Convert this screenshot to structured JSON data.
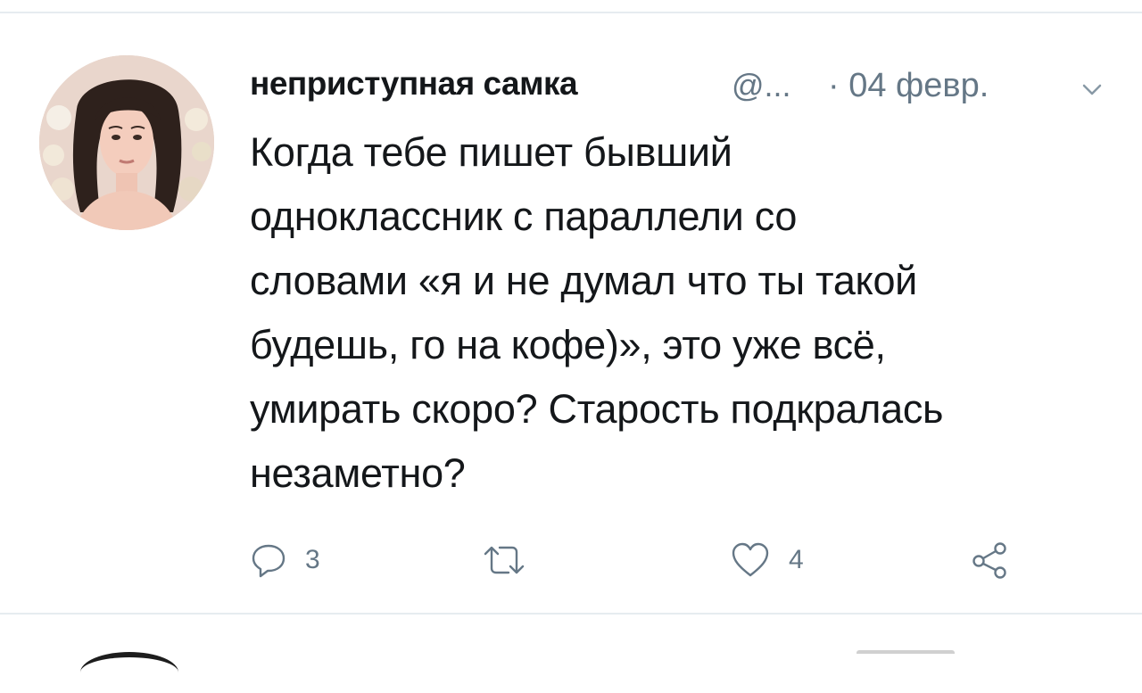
{
  "tweet": {
    "display_name": "неприступная самка",
    "handle": "@...",
    "date": "· 04 февр.",
    "text": "Когда тебе пишет бывший\nодноклассник с параллели со\nсловами «я и не думал что ты такой\nбудешь, го на кофе)», это уже всё,\nумирать скоро? Старость подкралась\nнезаметно?",
    "actions": {
      "reply_icon": "reply-icon",
      "reply_count": "3",
      "retweet_icon": "retweet-icon",
      "like_icon": "heart-icon",
      "like_count": "4",
      "share_icon": "share-icon"
    },
    "menu_icon": "chevron-down-icon"
  },
  "colors": {
    "text_primary": "#14171a",
    "text_secondary": "#657786",
    "divider": "#e6ecf0"
  }
}
